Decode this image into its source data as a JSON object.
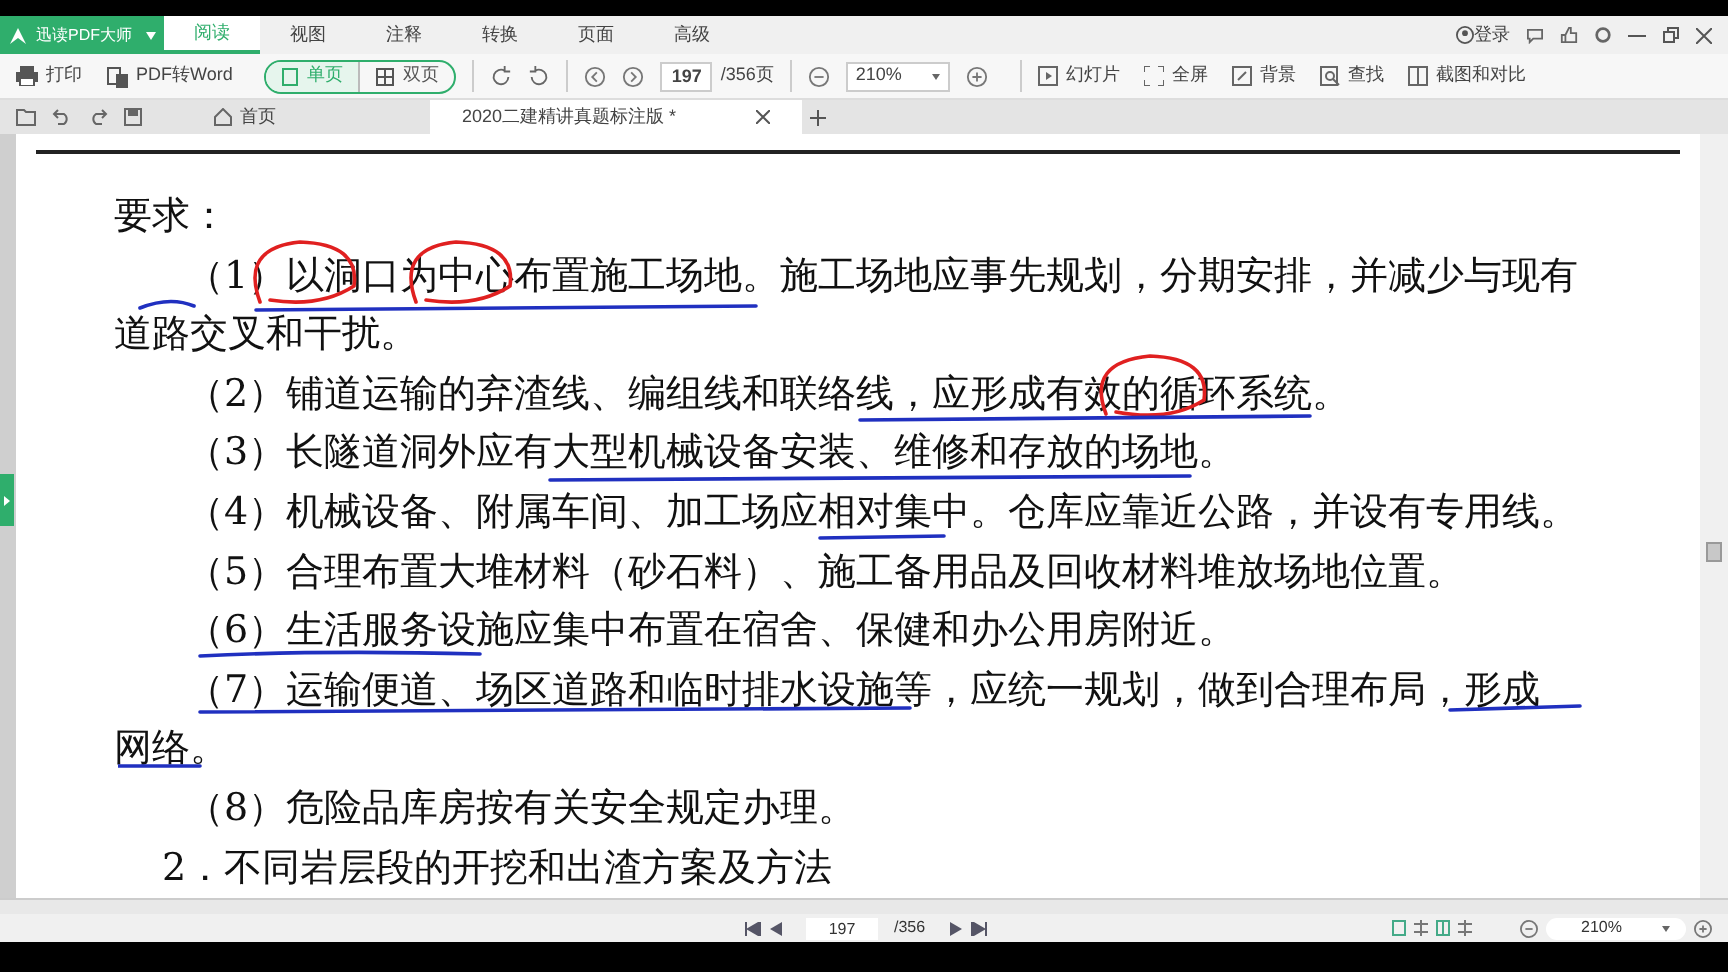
{
  "app": {
    "name": "迅读PDF大师",
    "menu_tabs": [
      {
        "label": "阅读",
        "selected": true
      },
      {
        "label": "视图",
        "selected": false
      },
      {
        "label": "注释",
        "selected": false
      },
      {
        "label": "转换",
        "selected": false
      },
      {
        "label": "页面",
        "selected": false
      },
      {
        "label": "高级",
        "selected": false
      }
    ],
    "login": "登录"
  },
  "toolbar": {
    "print": "打印",
    "to_word": "PDF转Word",
    "view_modes": [
      {
        "label": "单页",
        "selected": true
      },
      {
        "label": "双页",
        "selected": false
      }
    ],
    "page": "197",
    "page_total": "/356页",
    "zoom": "210%",
    "tools": [
      "幻灯片",
      "全屏",
      "背景",
      "查找",
      "截图和对比"
    ]
  },
  "doc_tabs": [
    {
      "label": "首页",
      "selected": false,
      "closable": false
    },
    {
      "label": "2020二建精讲真题标注版 *",
      "selected": true,
      "closable": true
    }
  ],
  "document": {
    "lines": [
      {
        "kind": "heading",
        "text": "要求："
      },
      {
        "kind": "para",
        "text": "（1）以洞口为中心布置施工场地。施工场地应事先规划，分期安排，并减少与现有"
      },
      {
        "kind": "cont",
        "text": "道路交叉和干扰。"
      },
      {
        "kind": "para",
        "text": "（2）铺道运输的弃渣线、编组线和联络线，应形成有效的循环系统。"
      },
      {
        "kind": "para",
        "text": "（3）长隧道洞外应有大型机械设备安装、维修和存放的场地。"
      },
      {
        "kind": "para",
        "text": "（4）机械设备、附属车间、加工场应相对集中。仓库应靠近公路，并设有专用线。"
      },
      {
        "kind": "para",
        "text": "（5）合理布置大堆材料（砂石料）、施工备用品及回收材料堆放场地位置。"
      },
      {
        "kind": "para",
        "text": "（6）生活服务设施应集中布置在宿舍、保健和办公用房附近。"
      },
      {
        "kind": "para",
        "text": "（7）运输便道、场区道路和临时排水设施等，应统一规划，做到合理布局，形成"
      },
      {
        "kind": "cont",
        "text": "网络。"
      },
      {
        "kind": "para",
        "text": "（8）危险品库房按有关安全规定办理。"
      },
      {
        "kind": "section",
        "text": "2．不同岩层段的开挖和出渣方案及方法"
      }
    ]
  },
  "status_bar": {
    "page": "197",
    "page_total": "/356",
    "zoom": "210%"
  }
}
